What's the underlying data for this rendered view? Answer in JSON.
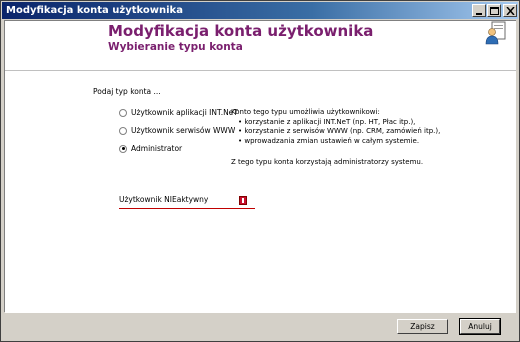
{
  "window": {
    "title": "Modyfikacja konta użytkownika"
  },
  "header": {
    "title": "Modyfikacja konta użytkownika",
    "subtitle": "Wybieranie typu konta"
  },
  "form": {
    "section_label": "Podaj typ konta ...",
    "options": [
      {
        "label": "Użytkownik aplikacji INT.NeT",
        "checked": false
      },
      {
        "label": "Użytkownik serwisów WWW",
        "checked": false
      },
      {
        "label": "Administrator",
        "checked": true
      }
    ],
    "description": {
      "intro": "Konto tego typu umożliwia użytkownikowi:",
      "bullets": [
        "korzystanie z aplikacji INT.NeT (np. HT, Płac itp.),",
        "korzystanie z serwisów WWW (np. CRM, zamówień itp.),",
        "wprowadzania zmian ustawień w całym systemie."
      ],
      "footer": "Z tego typu konta korzystają administratorzy systemu."
    },
    "inactive_label": "Użytkownik NIEaktywny"
  },
  "buttons": {
    "save": "Zapisz",
    "cancel": "Anuluj"
  },
  "colors": {
    "title_bar_start": "#0a246a",
    "header_text": "#7a1f6e",
    "inactive_underline": "#c00000"
  }
}
